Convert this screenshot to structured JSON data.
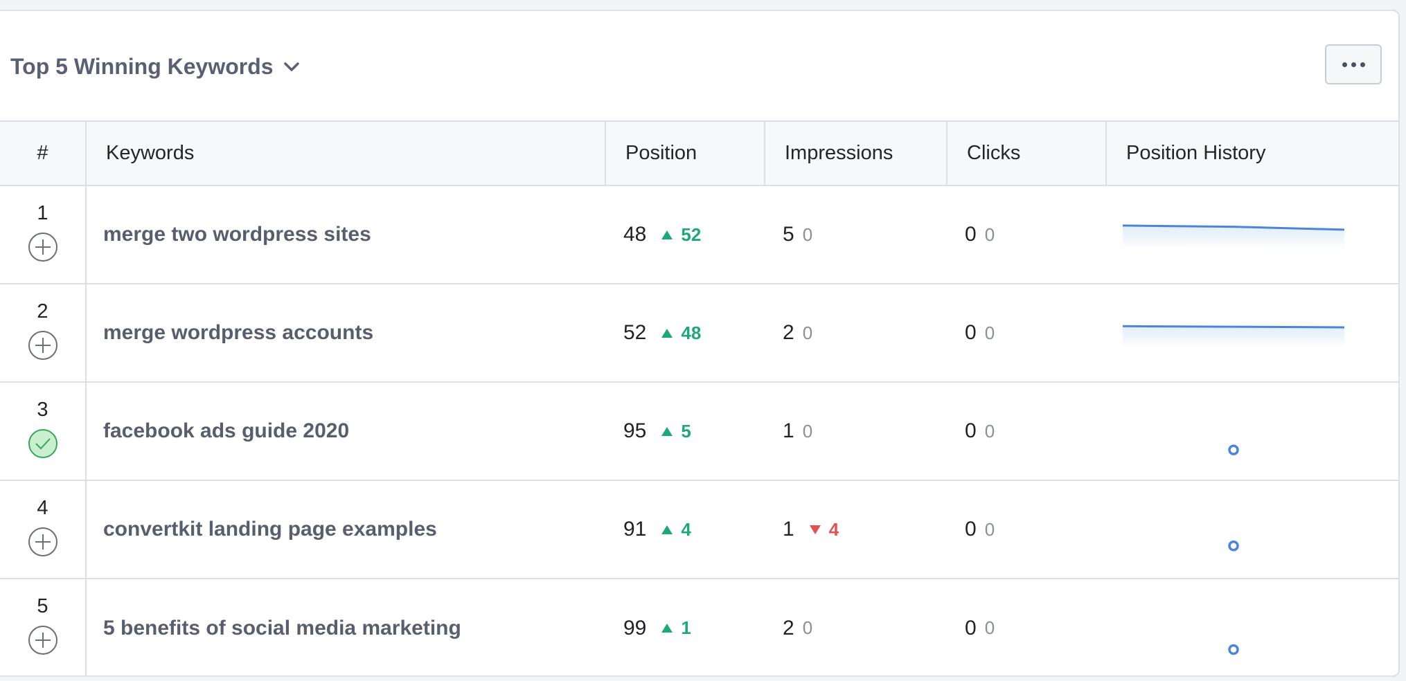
{
  "widget": {
    "title": "Top 5 Winning Keywords",
    "menu_icon": "more-dots-icon",
    "dropdown_icon": "chevron-down-icon"
  },
  "colors": {
    "up": "#1fa77a",
    "down": "#e05252",
    "sparkline": "#4a86d8",
    "title": "#5b5f73"
  },
  "table": {
    "headers": [
      "#",
      "Keywords",
      "Position",
      "Impressions",
      "Clicks",
      "Position History"
    ],
    "rows": [
      {
        "index": "1",
        "status": "add",
        "keyword": "merge two wordpress sites",
        "position": "48",
        "position_change": "52",
        "position_dir": "up",
        "impressions": "5",
        "impressions_change": "0",
        "impressions_dir": "none",
        "clicks": "0",
        "clicks_change": "0",
        "history": "line",
        "history_values": [
          48,
          50,
          55
        ]
      },
      {
        "index": "2",
        "status": "add",
        "keyword": "merge wordpress accounts",
        "position": "52",
        "position_change": "48",
        "position_dir": "up",
        "impressions": "2",
        "impressions_change": "0",
        "impressions_dir": "none",
        "clicks": "0",
        "clicks_change": "0",
        "history": "line",
        "history_values": [
          52,
          53,
          54
        ]
      },
      {
        "index": "3",
        "status": "tracked",
        "keyword": "facebook ads guide 2020",
        "position": "95",
        "position_change": "5",
        "position_dir": "up",
        "impressions": "1",
        "impressions_change": "0",
        "impressions_dir": "none",
        "clicks": "0",
        "clicks_change": "0",
        "history": "point",
        "history_values": [
          95
        ]
      },
      {
        "index": "4",
        "status": "add",
        "keyword": "convertkit landing page examples",
        "position": "91",
        "position_change": "4",
        "position_dir": "up",
        "impressions": "1",
        "impressions_change": "4",
        "impressions_dir": "down",
        "clicks": "0",
        "clicks_change": "0",
        "history": "point",
        "history_values": [
          91
        ]
      },
      {
        "index": "5",
        "status": "add",
        "keyword": "5 benefits of social media marketing",
        "position": "99",
        "position_change": "1",
        "position_dir": "up",
        "impressions": "2",
        "impressions_change": "0",
        "impressions_dir": "none",
        "clicks": "0",
        "clicks_change": "0",
        "history": "point",
        "history_values": [
          99
        ]
      }
    ]
  }
}
